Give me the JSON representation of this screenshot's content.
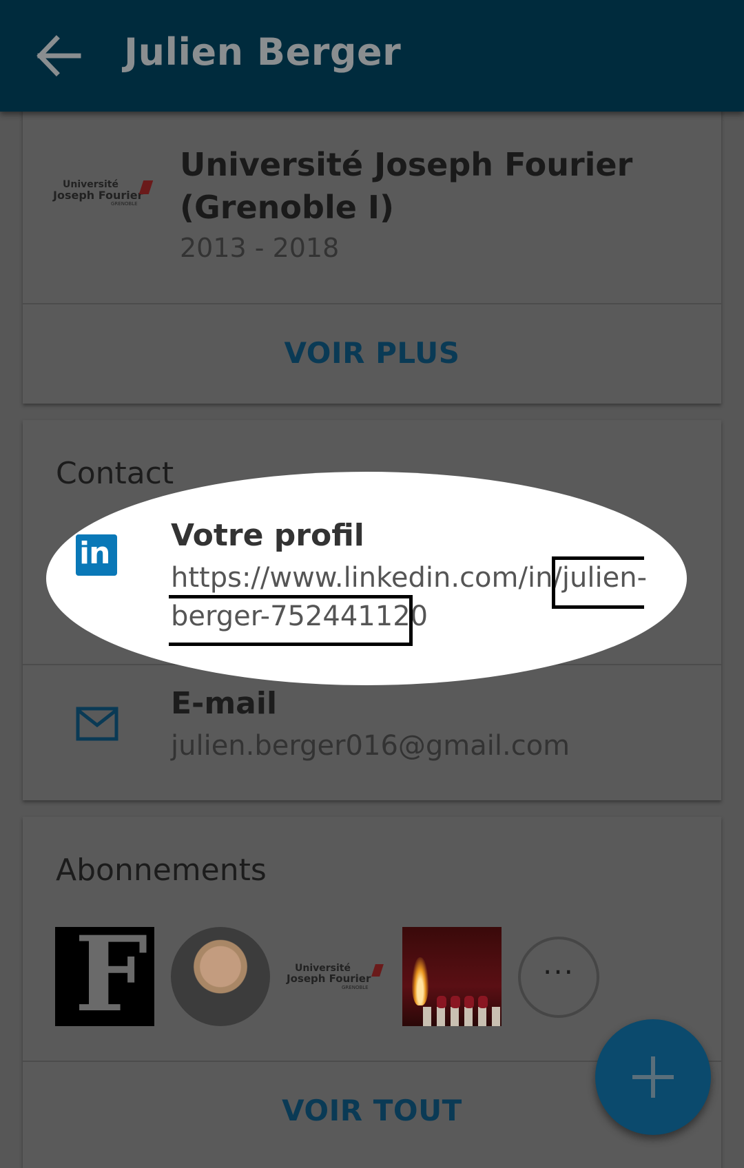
{
  "header": {
    "title": "Julien Berger",
    "back_icon": "arrow-left-icon",
    "background": "#002b3d"
  },
  "education": {
    "logo_lines": [
      "Université",
      "Joseph Fourier",
      "GRENOBLE"
    ],
    "school_name": "Université Joseph Fourier (Grenoble I)",
    "years": "2013 - 2018",
    "see_more_label": "VOIR PLUS"
  },
  "contact": {
    "section_title": "Contact",
    "profile": {
      "icon": "linkedin-icon",
      "icon_text": "in",
      "title": "Votre profil",
      "url_line1": "https://www.linkedin.com/in/julien-",
      "url_line2": "berger-752441120"
    },
    "email": {
      "icon": "mail-icon",
      "title": "E-mail",
      "value": "julien.berger016@gmail.com"
    }
  },
  "subscriptions": {
    "section_title": "Abonnements",
    "forbes_letter": "F",
    "ujf_logo_lines": [
      "Université",
      "Joseph Fourier",
      "GRENOBLE"
    ],
    "more_label": "···",
    "see_all_label": "VOIR TOUT"
  },
  "fab": {
    "icon": "plus-icon",
    "color": "#0b4a6d"
  },
  "colors": {
    "accent": "#0a3a55",
    "linkedin_blue": "#0a78b7",
    "overlay": "#575757",
    "spotlight": "#ffffff"
  }
}
